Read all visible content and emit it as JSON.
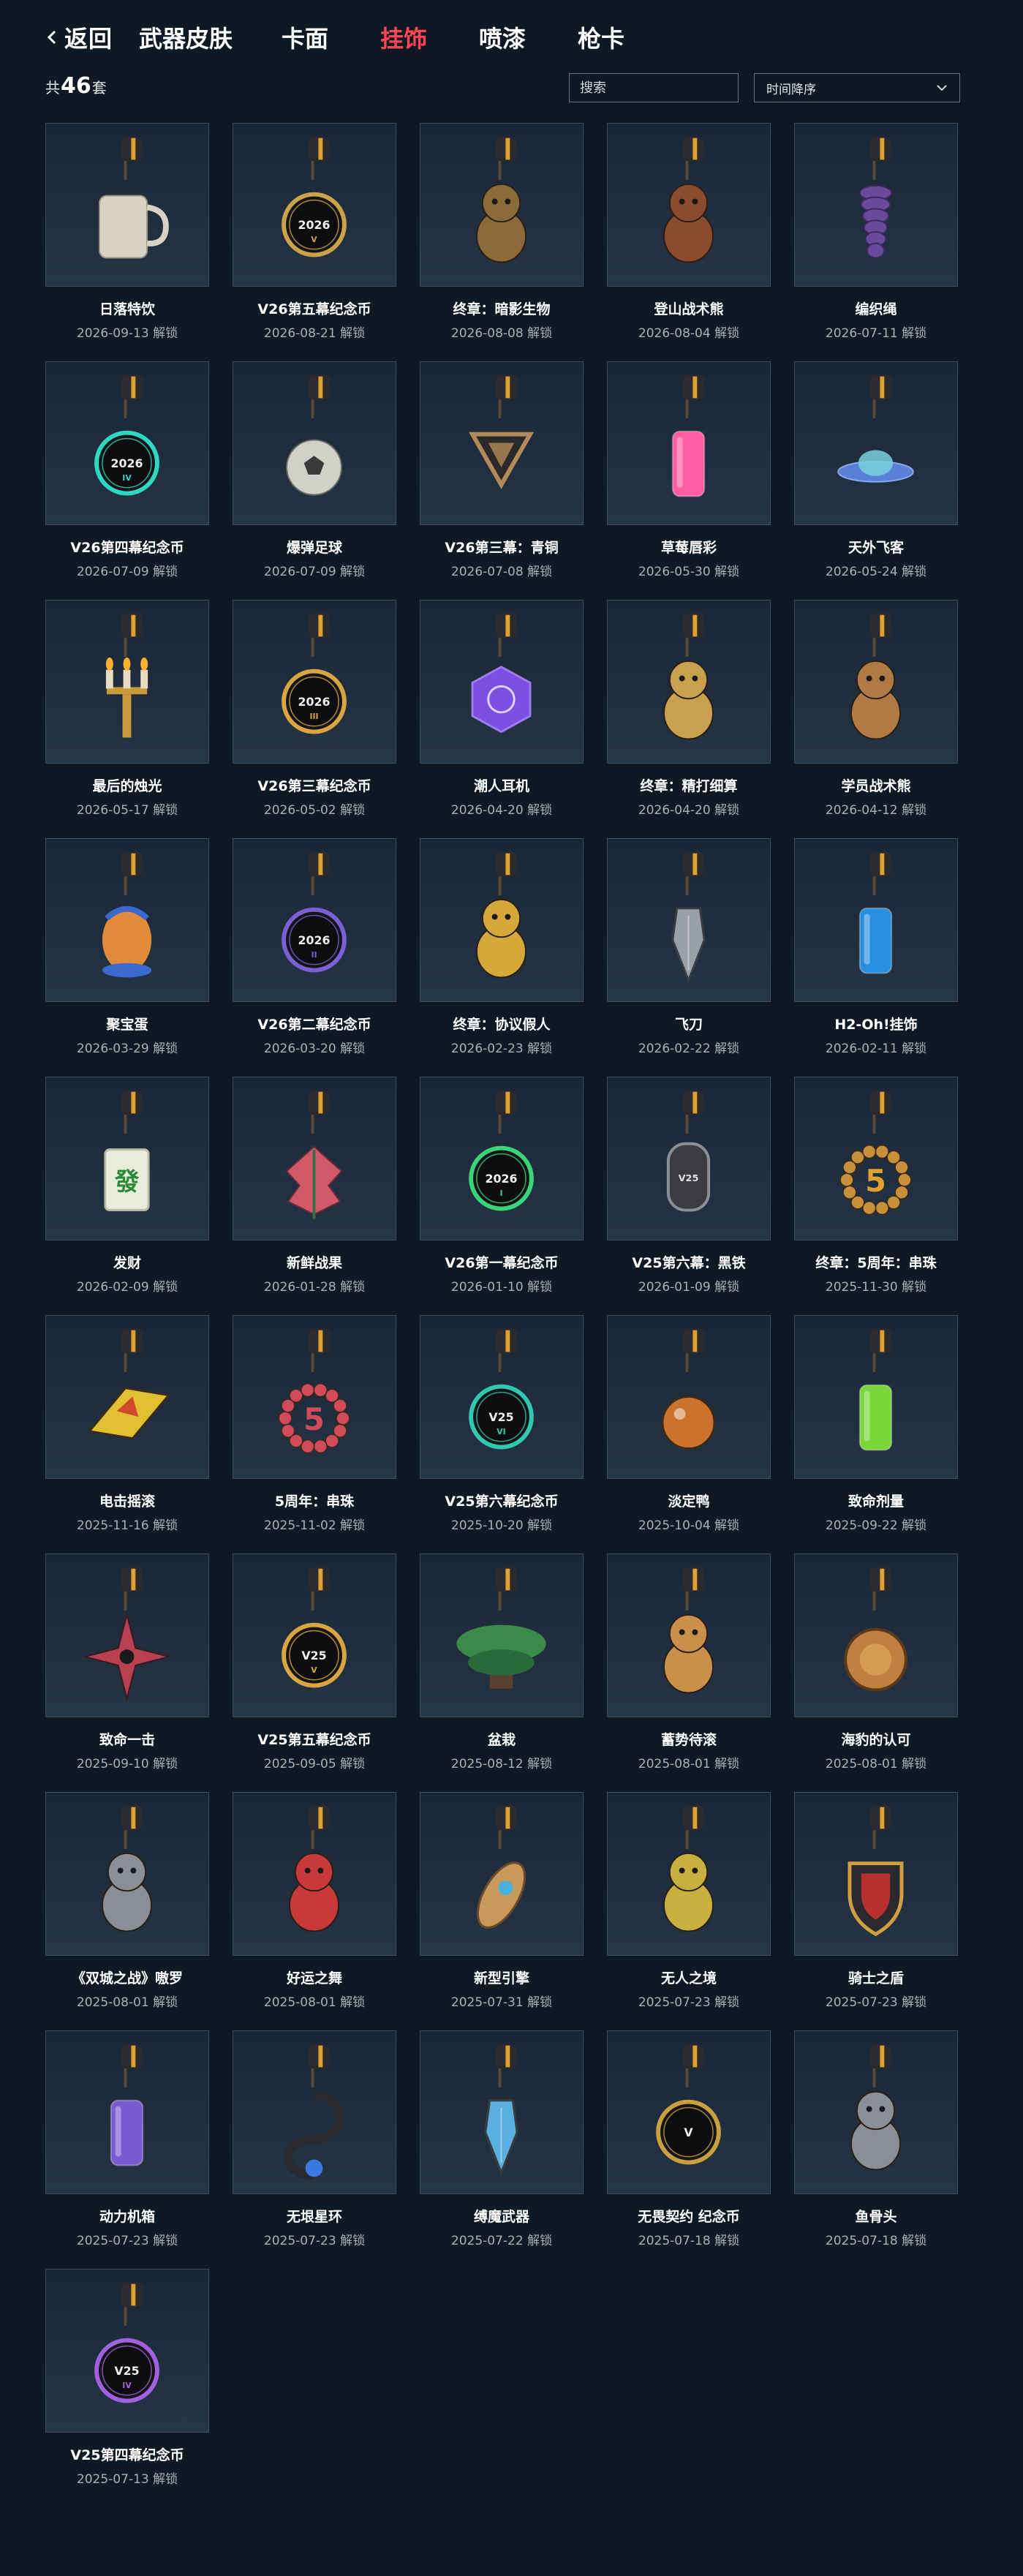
{
  "nav": {
    "back_label": "返回",
    "tabs": [
      {
        "label": "武器皮肤",
        "active": false
      },
      {
        "label": "卡面",
        "active": false
      },
      {
        "label": "挂饰",
        "active": true
      },
      {
        "label": "喷漆",
        "active": false
      },
      {
        "label": "枪卡",
        "active": false
      }
    ]
  },
  "toolbar": {
    "count_prefix": "共",
    "count": "46",
    "count_suffix": "套",
    "search_placeholder": "搜索",
    "sort_value": "时间降序"
  },
  "colors": {
    "accent": "#ff4655",
    "background": "#0f1923",
    "card_border": "#3d4b5a"
  },
  "items": [
    {
      "name": "日落特饮",
      "date": "2026-09-13 解锁",
      "icon": "mug-charm",
      "color": "#d8d2c4"
    },
    {
      "name": "V26第五幕纪念币",
      "date": "2026-08-21 解锁",
      "icon": "coin-charm",
      "color": "#c9a24a",
      "coin_text": "2026",
      "coin_sub": "V"
    },
    {
      "name": "终章：暗影生物",
      "date": "2026-08-08 解锁",
      "icon": "creature-charm",
      "color": "#8b6a3a"
    },
    {
      "name": "登山战术熊",
      "date": "2026-08-04 解锁",
      "icon": "bear-charm",
      "color": "#8a4b2e"
    },
    {
      "name": "编织绳",
      "date": "2026-07-11 解锁",
      "icon": "rope-charm",
      "color": "#6a4a9a"
    },
    {
      "name": "V26第四幕纪念币",
      "date": "2026-07-09 解锁",
      "icon": "coin-charm",
      "color": "#2fd6c2",
      "coin_text": "2026",
      "coin_sub": "IV"
    },
    {
      "name": "爆弹足球",
      "date": "2026-07-09 解锁",
      "icon": "ball-charm",
      "color": "#d0d0c8"
    },
    {
      "name": "V26第三幕：青铜",
      "date": "2026-07-08 解锁",
      "icon": "triangle-charm",
      "color": "#b48a5a"
    },
    {
      "name": "草莓唇彩",
      "date": "2026-05-30 解锁",
      "icon": "lipgloss-charm",
      "color": "#ff5fa2"
    },
    {
      "name": "天外飞客",
      "date": "2026-05-24 解锁",
      "icon": "ufo-charm",
      "color": "#5a7fd6"
    },
    {
      "name": "最后的烛光",
      "date": "2026-05-17 解锁",
      "icon": "candle-charm",
      "color": "#c89a3a"
    },
    {
      "name": "V26第三幕纪念币",
      "date": "2026-05-02 解锁",
      "icon": "coin-charm",
      "color": "#d9a441",
      "coin_text": "2026",
      "coin_sub": "III"
    },
    {
      "name": "潮人耳机",
      "date": "2026-04-20 解锁",
      "icon": "hexagon-charm",
      "color": "#7b4fe0"
    },
    {
      "name": "终章：精打细算",
      "date": "2026-04-20 解锁",
      "icon": "pig-charm",
      "color": "#c8a050"
    },
    {
      "name": "学员战术熊",
      "date": "2026-04-12 解锁",
      "icon": "bear-charm",
      "color": "#b07a45"
    },
    {
      "name": "聚宝蛋",
      "date": "2026-03-29 解锁",
      "icon": "egg-charm",
      "color": "#e08a3a"
    },
    {
      "name": "V26第二幕纪念币",
      "date": "2026-03-20 解锁",
      "icon": "coin-charm",
      "color": "#7a5fd6",
      "coin_text": "2026",
      "coin_sub": "II"
    },
    {
      "name": "终章：协议假人",
      "date": "2026-02-23 解锁",
      "icon": "dummy-charm",
      "color": "#d4a83a"
    },
    {
      "name": "飞刀",
      "date": "2026-02-22 解锁",
      "icon": "knife-charm",
      "color": "#9aa0a8"
    },
    {
      "name": "H2-Oh!挂饰",
      "date": "2026-02-11 解锁",
      "icon": "bottle-charm",
      "color": "#2a8ee0"
    },
    {
      "name": "发财",
      "date": "2026-02-09 解锁",
      "icon": "mahjong-charm",
      "color": "#e8ecd8",
      "tile_text": "發"
    },
    {
      "name": "新鲜战果",
      "date": "2026-01-28 解锁",
      "icon": "leaf-charm",
      "color": "#d05a6a"
    },
    {
      "name": "V26第一幕纪念币",
      "date": "2026-01-10 解锁",
      "icon": "coin-charm",
      "color": "#3ad47a",
      "coin_text": "2026",
      "coin_sub": "I"
    },
    {
      "name": "V25第六幕：黑铁",
      "date": "2026-01-09 解锁",
      "icon": "tag-charm",
      "color": "#6a6e74",
      "coin_text": "V25"
    },
    {
      "name": "终章：5周年：串珠",
      "date": "2025-11-30 解锁",
      "icon": "wreath-charm",
      "color": "#c8903a",
      "coin_text": "5"
    },
    {
      "name": "电击摇滚",
      "date": "2025-11-16 解锁",
      "icon": "guitar-charm",
      "color": "#e0c030"
    },
    {
      "name": "5周年：串珠",
      "date": "2025-11-02 解锁",
      "icon": "beads-charm",
      "color": "#d04a5a",
      "coin_text": "5"
    },
    {
      "name": "V25第六幕纪念币",
      "date": "2025-10-20 解锁",
      "icon": "coin-charm",
      "color": "#30c8b0",
      "coin_text": "V25",
      "coin_sub": "VI"
    },
    {
      "name": "淡定鸭",
      "date": "2025-10-04 解锁",
      "icon": "orb-charm",
      "color": "#e07a2a"
    },
    {
      "name": "致命剂量",
      "date": "2025-09-22 解锁",
      "icon": "syringe-charm",
      "color": "#7ad63a"
    },
    {
      "name": "致命一击",
      "date": "2025-09-10 解锁",
      "icon": "shuriken-charm",
      "color": "#b84050"
    },
    {
      "name": "V25第五幕纪念币",
      "date": "2025-09-05 解锁",
      "icon": "coin-charm",
      "color": "#d9a441",
      "coin_text": "V25",
      "coin_sub": "V"
    },
    {
      "name": "盆栽",
      "date": "2025-08-12 解锁",
      "icon": "bonsai-charm",
      "color": "#3a8a4a"
    },
    {
      "name": "蓄势待滚",
      "date": "2025-08-01 解锁",
      "icon": "hamster-charm",
      "color": "#c8904a"
    },
    {
      "name": "海豹的认可",
      "date": "2025-08-01 解锁",
      "icon": "seal-charm",
      "color": "#c08040"
    },
    {
      "name": "《双城之战》嗷罗",
      "date": "2025-08-01 解锁",
      "icon": "cat-charm",
      "color": "#8a8e96"
    },
    {
      "name": "好运之舞",
      "date": "2025-08-01 解锁",
      "icon": "lion-charm",
      "color": "#c83a3a"
    },
    {
      "name": "新型引擎",
      "date": "2025-07-31 解锁",
      "icon": "rocket-charm",
      "color": "#c89a5a"
    },
    {
      "name": "无人之境",
      "date": "2025-07-23 解锁",
      "icon": "robot-charm",
      "color": "#c8b040"
    },
    {
      "name": "骑士之盾",
      "date": "2025-07-23 解锁",
      "icon": "shield-charm",
      "color": "#b83030"
    },
    {
      "name": "动力机箱",
      "date": "2025-07-23 解锁",
      "icon": "box-charm",
      "color": "#7a5ad0"
    },
    {
      "name": "无垠星环",
      "date": "2025-07-23 解锁",
      "icon": "ring-charm",
      "color": "#3a7ae0"
    },
    {
      "name": "缚魔武器",
      "date": "2025-07-22 解锁",
      "icon": "blade-charm",
      "color": "#5ab0e0"
    },
    {
      "name": "无畏契约 纪念币",
      "date": "2025-07-18 解锁",
      "icon": "v-coin-charm",
      "color": "#c8a040",
      "coin_text": "V"
    },
    {
      "name": "鱼骨头",
      "date": "2025-07-18 解锁",
      "icon": "fishbone-charm",
      "color": "#8a8e96"
    },
    {
      "name": "V25第四幕纪念币",
      "date": "2025-07-13 解锁",
      "icon": "coin-charm",
      "color": "#a060e0",
      "coin_text": "V25",
      "coin_sub": "IV"
    }
  ]
}
